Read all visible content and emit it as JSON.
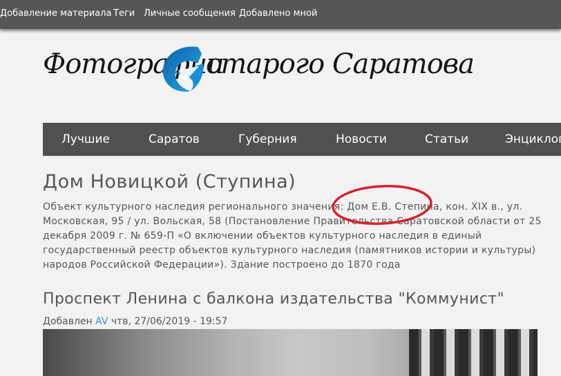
{
  "topbar": {
    "links": [
      "Добавление материала",
      "Теги",
      "Личные сообщения",
      "Добавлено мной"
    ]
  },
  "logo": {
    "left_text": "Фотографии",
    "right_text": "старого Саратова",
    "mark_icon": "blue-swoosh-logo-icon",
    "accent_color": "#1a8fd6"
  },
  "nav": {
    "items": [
      "Лучшие",
      "Саратов",
      "Губерния",
      "Новости",
      "Статьи",
      "Энциклоп"
    ]
  },
  "page": {
    "title": "Дом Новицкой (Ступина)",
    "description": "Объект культурного наследия регионального значения: Дом Е.В. Степина, кон. XIX в., ул. Московская, 95 / ул. Вольская, 58 (Постановление Правительства Саратовской области от 25 декабря 2009 г. № 659-П «О включении объектов культурного наследия в единый государственный реестр объектов культурного наследия (памятников истории и культуры) народов Российской Федерации»). Здание построено до 1870 года",
    "annotation_color": "#d8202a"
  },
  "post": {
    "title": "Проспект Ленина с балкона издательства \"Коммунист\"",
    "added_label": "Добавлен",
    "author": "AV",
    "date": "чтв, 27/06/2019 - 19:57"
  },
  "colors": {
    "topbar": "#565656",
    "nav": "#505050",
    "background": "#f2f2f2",
    "link": "#3c8dbc"
  }
}
